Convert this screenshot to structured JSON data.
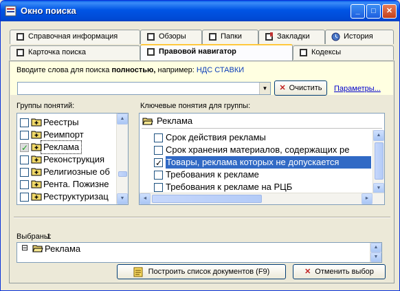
{
  "window": {
    "title": "Окно поиска",
    "minimize": "_",
    "maximize": "□",
    "close": "✕"
  },
  "tabs_top": [
    {
      "label": "Справочная информация",
      "icon": "book-icon"
    },
    {
      "label": "Обзоры",
      "icon": "book-icon"
    },
    {
      "label": "Папки",
      "icon": "book-icon"
    },
    {
      "label": "Закладки",
      "icon": "bookmark-icon"
    },
    {
      "label": "История",
      "icon": "history-icon"
    }
  ],
  "tabs_bottom": [
    {
      "label": "Карточка поиска",
      "icon": "card-icon"
    },
    {
      "label": "Правовой навигатор",
      "icon": "navigator-icon",
      "active": true
    },
    {
      "label": "Кодексы",
      "icon": "codex-icon"
    }
  ],
  "search": {
    "hint_prefix": "Вводите слова для поиска ",
    "hint_bold": "полностью,",
    "hint_middle": "  например: ",
    "hint_example": "НДС СТАВКИ",
    "value": "",
    "clear_label": "Очистить",
    "params_link": "Параметры..."
  },
  "groups": {
    "label": "Группы понятий:",
    "items": [
      {
        "label": "Реестры",
        "checked": false
      },
      {
        "label": "Реимпорт",
        "checked": false
      },
      {
        "label": "Реклама",
        "checked": true,
        "focused": true
      },
      {
        "label": "Реконструкция",
        "checked": false
      },
      {
        "label": "Религиозные об",
        "checked": false
      },
      {
        "label": "Рента. Пожизне",
        "checked": false
      },
      {
        "label": "Реструктуризац",
        "checked": false
      }
    ]
  },
  "keywords": {
    "label": "Ключевые понятия для группы:",
    "group_title": "Реклама",
    "items": [
      {
        "label": "Срок действия рекламы",
        "checked": false
      },
      {
        "label": "Срок хранения материалов, содержащих ре",
        "checked": false
      },
      {
        "label": "Товары, реклама которых не допускается",
        "checked": true,
        "selected": true
      },
      {
        "label": "Требования к рекламе",
        "checked": false
      },
      {
        "label": "Требования к рекламе на РЦБ",
        "checked": false
      }
    ]
  },
  "selected": {
    "label": "Выбраны:",
    "count": "1",
    "tree_expander": "⊟",
    "item": "Реклама"
  },
  "actions": {
    "build_label": "Построить список документов (F9)",
    "cancel_label": "Отменить выбор"
  },
  "colors": {
    "accent": "#0055e5",
    "selection": "#316ac5",
    "hint_bg": "#ffffe1"
  }
}
